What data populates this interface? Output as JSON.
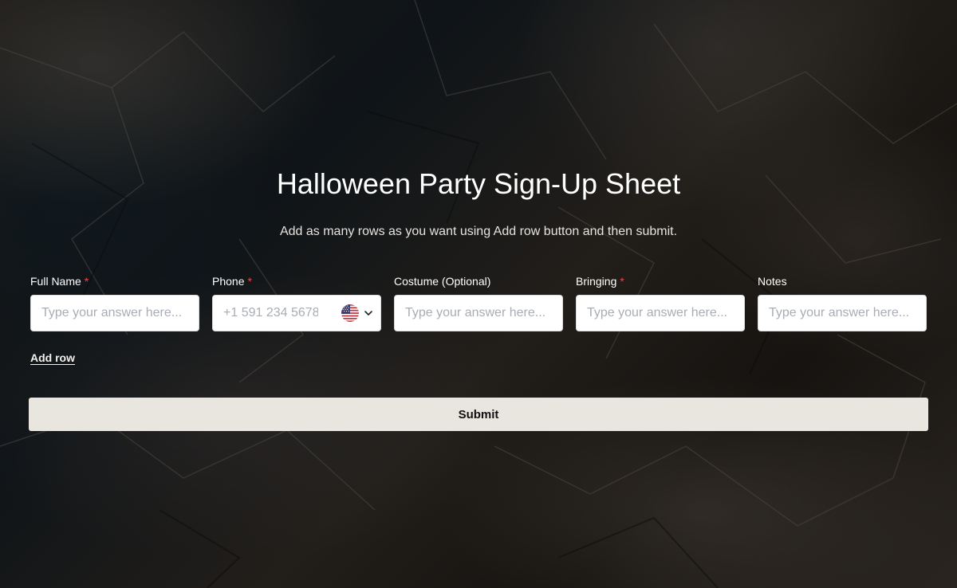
{
  "page": {
    "title": "Halloween Party Sign-Up Sheet",
    "subtitle": "Add as many rows as you want using Add row button and then submit."
  },
  "fields": [
    {
      "label": "Full Name",
      "required": "*",
      "placeholder": "Type your answer here..."
    },
    {
      "label": "Phone",
      "required": "*",
      "placeholder": "+1 591 234 5678",
      "country_icon": "us-flag-icon"
    },
    {
      "label": "Costume (Optional)",
      "placeholder": "Type your answer here..."
    },
    {
      "label": "Bringing",
      "required": "*",
      "placeholder": "Type your answer here..."
    },
    {
      "label": "Notes",
      "placeholder": "Type your answer here..."
    }
  ],
  "actions": {
    "add_row_label": "Add row",
    "submit_label": "Submit"
  },
  "colors": {
    "required_star": "#e5484d",
    "submit_background": "#e9e5df",
    "title_text": "#ffffff"
  }
}
